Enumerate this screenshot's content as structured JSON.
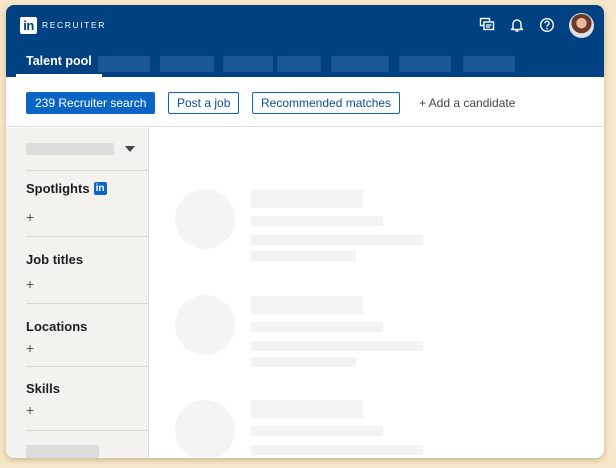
{
  "header": {
    "brand_logo": "in",
    "brand_text": "RECRUITER",
    "icons": [
      "messages-icon",
      "notifications-bell-icon",
      "help-icon"
    ],
    "nav_color": "#004182"
  },
  "tabs": {
    "active_label": "Talent pool"
  },
  "actions": {
    "search_button": "239 Recruiter search",
    "post_job_button": "Post a job",
    "recommended_button": "Recommended matches",
    "add_candidate_button": "+ Add a candidate",
    "accent_color": "#0a66c2"
  },
  "sidebar": {
    "sections": [
      {
        "title": "Spotlights",
        "badge": "in",
        "add_symbol": "+"
      },
      {
        "title": "Job titles",
        "add_symbol": "+"
      },
      {
        "title": "Locations",
        "add_symbol": "+"
      },
      {
        "title": "Skills",
        "add_symbol": "+"
      }
    ]
  }
}
